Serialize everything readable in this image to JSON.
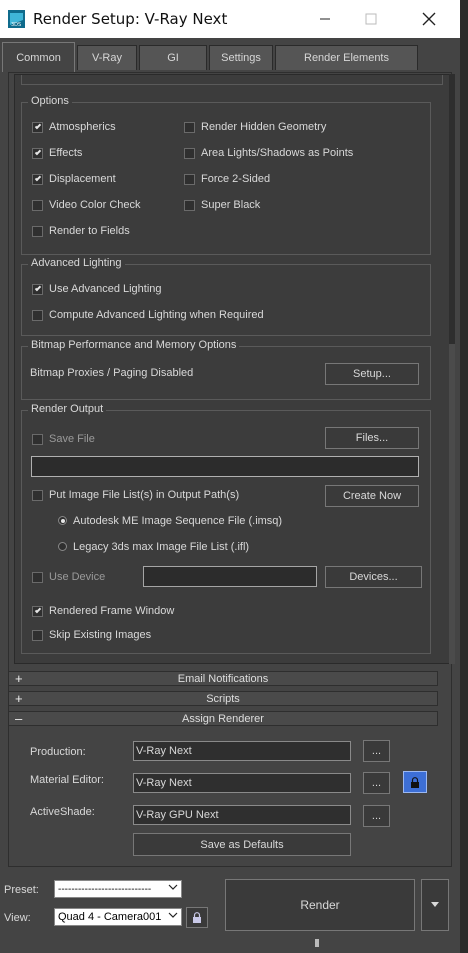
{
  "window": {
    "title": "Render Setup: V-Ray Next"
  },
  "tabs": [
    {
      "label": "Common",
      "active": true
    },
    {
      "label": "V-Ray"
    },
    {
      "label": "GI"
    },
    {
      "label": "Settings"
    },
    {
      "label": "Render Elements"
    }
  ],
  "options": {
    "legend": "Options",
    "items": [
      {
        "label": "Atmospherics",
        "checked": true
      },
      {
        "label": "Effects",
        "checked": true
      },
      {
        "label": "Displacement",
        "checked": true
      },
      {
        "label": "Video Color Check",
        "checked": false
      },
      {
        "label": "Render to Fields",
        "checked": false
      },
      {
        "label": "Render Hidden Geometry",
        "checked": false
      },
      {
        "label": "Area Lights/Shadows as Points",
        "checked": false
      },
      {
        "label": "Force 2-Sided",
        "checked": false
      },
      {
        "label": "Super Black",
        "checked": false
      }
    ]
  },
  "advanced_lighting": {
    "legend": "Advanced Lighting",
    "use_advanced": {
      "label": "Use Advanced Lighting",
      "checked": true
    },
    "compute_when_required": {
      "label": "Compute Advanced Lighting when Required",
      "checked": false
    }
  },
  "bitmap": {
    "legend": "Bitmap Performance and Memory Options",
    "status": "Bitmap Proxies / Paging Disabled",
    "setup_button": "Setup..."
  },
  "render_output": {
    "legend": "Render Output",
    "save_file": {
      "label": "Save File",
      "checked": false
    },
    "files_button": "Files...",
    "file_path": "",
    "put_image_list": {
      "label": "Put Image File List(s) in Output Path(s)",
      "checked": false
    },
    "create_now_button": "Create Now",
    "radio_imsq": {
      "label": "Autodesk ME Image Sequence File (.imsq)",
      "selected": true
    },
    "radio_ifl": {
      "label": "Legacy 3ds max Image File List (.ifl)",
      "selected": false
    },
    "use_device": {
      "label": "Use Device",
      "checked": false
    },
    "device_field": "",
    "devices_button": "Devices...",
    "rendered_frame_window": {
      "label": "Rendered Frame Window",
      "checked": true
    },
    "skip_existing": {
      "label": "Skip Existing Images",
      "checked": false
    }
  },
  "rollouts": {
    "email": {
      "sign": "+",
      "label": "Email Notifications"
    },
    "scripts": {
      "sign": "+",
      "label": "Scripts"
    },
    "assign_renderer": {
      "sign": "–",
      "label": "Assign Renderer"
    }
  },
  "assign_renderer": {
    "production": {
      "label": "Production:",
      "value": "V-Ray Next"
    },
    "material_editor": {
      "label": "Material Editor:",
      "value": "V-Ray Next"
    },
    "activeshade": {
      "label": "ActiveShade:",
      "value": "V-Ray GPU Next"
    },
    "browse_label": "...",
    "save_defaults": "Save as Defaults"
  },
  "bottom": {
    "preset_label": "Preset:",
    "preset_value": "----------------------------",
    "view_label": "View:",
    "view_value": "Quad 4 - Camera001",
    "render_button": "Render"
  },
  "colors": {
    "lock_active": "#3d6fd6",
    "panel": "#3c3c3c"
  }
}
